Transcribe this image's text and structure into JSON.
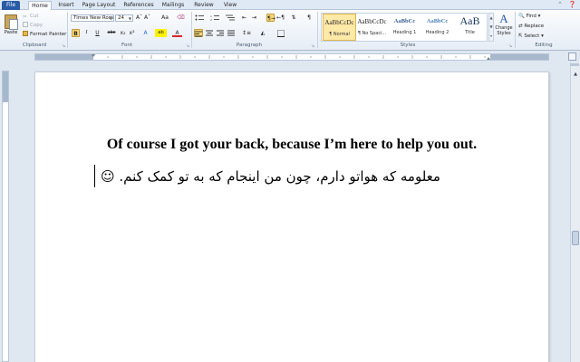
{
  "tabs": [
    "File",
    "Home",
    "Insert",
    "Page Layout",
    "References",
    "Mailings",
    "Review",
    "View"
  ],
  "active_tab": "Home",
  "clipboard": {
    "paste": "Paste",
    "cut": "Cut",
    "copy": "Copy",
    "format_painter": "Format Painter",
    "group": "Clipboard"
  },
  "font": {
    "name": "Times New Rom",
    "size": "24",
    "group": "Font",
    "bold": "B",
    "italic": "I",
    "underline": "U",
    "grow": "Aˆ",
    "shrink": "Aˇ",
    "case": "Aa",
    "strike": "abc",
    "sub": "x₂",
    "sup": "x²",
    "effects": "A",
    "highlight": "ab",
    "color": "A"
  },
  "paragraph": {
    "group": "Paragraph",
    "pilcrow": "¶"
  },
  "styles": {
    "group": "Styles",
    "items": [
      {
        "sample": "AaBbCcDc",
        "name": "¶ Normal"
      },
      {
        "sample": "AaBbCcDc",
        "name": "¶ No Spaci..."
      },
      {
        "sample": "AaBbCc",
        "name": "Heading 1"
      },
      {
        "sample": "AaBbCc",
        "name": "Heading 2"
      },
      {
        "sample": "AaB",
        "name": "Title"
      }
    ],
    "change_label": "Change Styles"
  },
  "editing": {
    "group": "Editing",
    "find": "Find",
    "replace": "Replace",
    "select": "Select"
  },
  "document": {
    "line1": "Of course I got your back, because I’m here to help you out.",
    "line2": "معلومه که هواتو دارم،  چون من اینجام که به تو کمک کنم.  ☺"
  },
  "colors": {
    "file_tab": "#2a5ba6",
    "ribbon_bg": "#f3f6fb",
    "highlight_on": "#fcd977",
    "heading_blue": "#365f91"
  }
}
